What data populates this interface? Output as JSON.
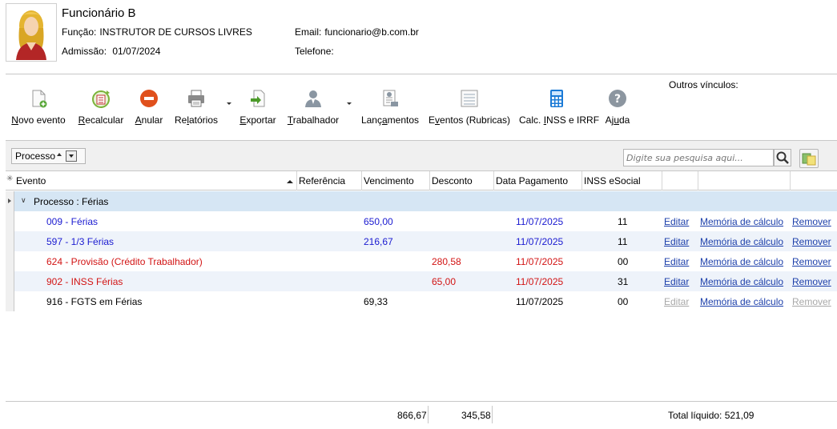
{
  "employee": {
    "name": "Funcionário B",
    "funcao_label": "Função:",
    "funcao": "INSTRUTOR DE CURSOS LIVRES",
    "admissao_label": "Admissão:",
    "admissao": "01/07/2024",
    "email_label": "Email:",
    "email": "funcionario@b.com.br",
    "telefone_label": "Telefone:",
    "telefone": ""
  },
  "outros_vinculos": "Outros vínculos:",
  "toolbar": {
    "items": [
      {
        "pre": "",
        "key": "N",
        "post": "ovo evento"
      },
      {
        "pre": "",
        "key": "R",
        "post": "ecalcular"
      },
      {
        "pre": "",
        "key": "A",
        "post": "nular"
      },
      {
        "pre": "Re",
        "key": "l",
        "post": "atórios"
      },
      {
        "pre": "",
        "key": "E",
        "post": "xportar"
      },
      {
        "pre": "",
        "key": "T",
        "post": "rabalhador"
      },
      {
        "pre": "Lanç",
        "key": "a",
        "post": "mentos"
      },
      {
        "pre": "E",
        "key": "v",
        "post": "entos (Rubricas)"
      },
      {
        "pre": "Calc. ",
        "key": "I",
        "post": "NSS e IRRF"
      },
      {
        "pre": "Aj",
        "key": "u",
        "post": "da"
      }
    ]
  },
  "group_by": {
    "label": "Processo"
  },
  "search": {
    "placeholder": "Digite sua pesquisa aqui..."
  },
  "columns": [
    "Evento",
    "Referência",
    "Vencimento",
    "Desconto",
    "Data Pagamento",
    "INSS eSocial"
  ],
  "group_row": {
    "label": "Processo : Férias"
  },
  "rows": [
    {
      "evento": "009 - Férias",
      "referencia": "",
      "vencimento": "650,00",
      "desconto": "",
      "data": "11/07/2025",
      "inss": "11",
      "editar": "Editar",
      "memoria": "Memória de cálculo",
      "remover": "Remover"
    },
    {
      "evento": "597 - 1/3 Férias",
      "referencia": "",
      "vencimento": "216,67",
      "desconto": "",
      "data": "11/07/2025",
      "inss": "11",
      "editar": "Editar",
      "memoria": "Memória de cálculo",
      "remover": "Remover"
    },
    {
      "evento": "624 - Provisão (Crédito Trabalhador)",
      "referencia": "",
      "vencimento": "",
      "desconto": "280,58",
      "data": "11/07/2025",
      "inss": "00",
      "editar": "Editar",
      "memoria": "Memória de cálculo",
      "remover": "Remover"
    },
    {
      "evento": "902 - INSS Férias",
      "referencia": "",
      "vencimento": "",
      "desconto": "65,00",
      "data": "11/07/2025",
      "inss": "31",
      "editar": "Editar",
      "memoria": "Memória de cálculo",
      "remover": "Remover"
    },
    {
      "evento": "916 - FGTS em Férias",
      "referencia": "",
      "vencimento": "69,33",
      "desconto": "",
      "data": "11/07/2025",
      "inss": "00",
      "editar": "Editar",
      "memoria": "Memória de cálculo",
      "remover": "Remover"
    }
  ],
  "totals": {
    "vencimento": "866,67",
    "desconto": "345,58",
    "liquido": "Total líquido: 521,09"
  },
  "colors": {
    "blue_text": "#1a1ad0",
    "red_text": "#d21414",
    "link": "#1c3faa",
    "group_row_bg": "#d6e6f4"
  }
}
